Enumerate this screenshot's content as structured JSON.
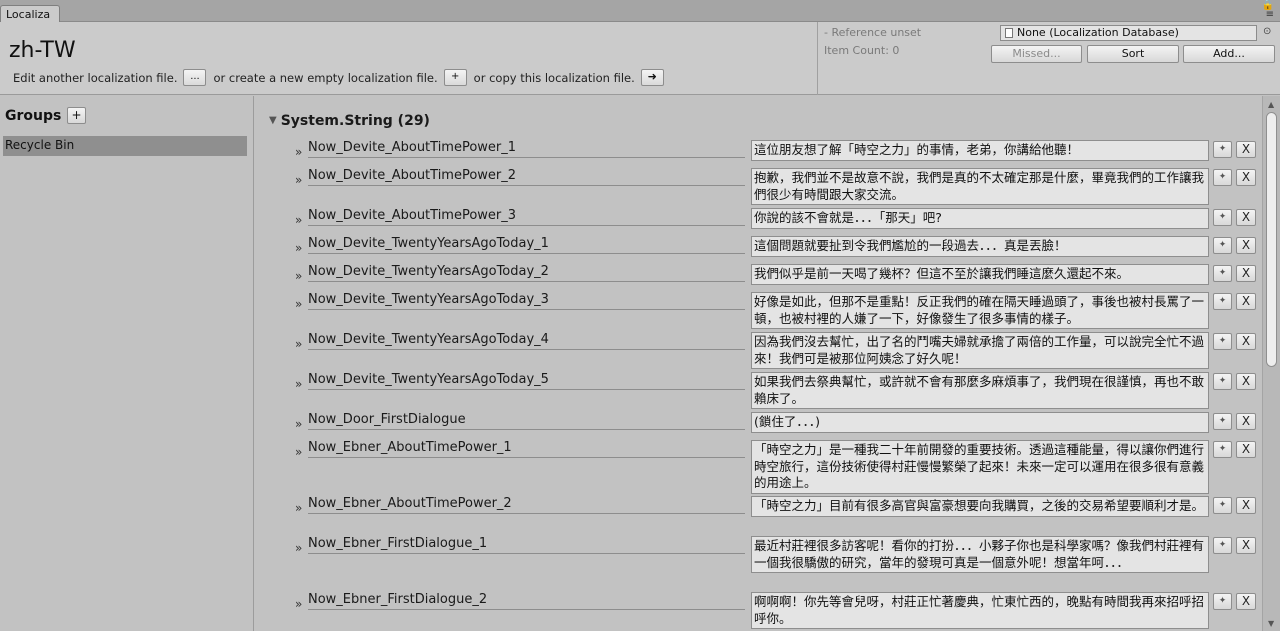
{
  "window": {
    "tab_label": "Localiza",
    "lock_glyph": "🔒",
    "menu_glyph": "≡"
  },
  "header": {
    "title": "zh-TW",
    "edit_text": "Edit another localization file.",
    "edit_button": "...",
    "create_text": "or create a new empty localization file.",
    "create_button": "+",
    "copy_text": "or copy this localization file.",
    "copy_button": "➜",
    "reference_status": "- Reference unset",
    "item_count": "Item Count: 0",
    "database_field": "None (Localization Database)",
    "missed_button": "Missed...",
    "sort_button": "Sort",
    "add_button": "Add..."
  },
  "sidebar": {
    "title": "Groups",
    "add_button": "+",
    "items": [
      {
        "label": "Recycle Bin"
      }
    ]
  },
  "section": {
    "title": "System.String (29)"
  },
  "entries": [
    {
      "key": "Now_Devite_AboutTimePower_1",
      "value": "這位朋友想了解「時空之力」的事情，老弟，你講給他聽！"
    },
    {
      "key": "Now_Devite_AboutTimePower_2",
      "value": "抱歉，我們並不是故意不說，我們是真的不太確定那是什麼，畢竟我們的工作讓我們很少有時間跟大家交流。"
    },
    {
      "key": "Now_Devite_AboutTimePower_3",
      "value": "你說的該不會就是．．．「那天」吧?"
    },
    {
      "key": "Now_Devite_TwentyYearsAgoToday_1",
      "value": "這個問題就要扯到令我們尷尬的一段過去．．．真是丟臉！"
    },
    {
      "key": "Now_Devite_TwentyYearsAgoToday_2",
      "value": "我們似乎是前一天喝了幾杯？但這不至於讓我們睡這麼久還起不來。"
    },
    {
      "key": "Now_Devite_TwentyYearsAgoToday_3",
      "value": "好像是如此，但那不是重點！反正我們的確在隔天睡過頭了，事後也被村長罵了一頓，也被村裡的人嫌了一下，好像發生了很多事情的樣子。"
    },
    {
      "key": "Now_Devite_TwentyYearsAgoToday_4",
      "value": "因為我們沒去幫忙，出了名的鬥嘴夫婦就承擔了兩倍的工作量，可以說完全忙不過來！我們可是被那位阿姨念了好久呢！"
    },
    {
      "key": "Now_Devite_TwentyYearsAgoToday_5",
      "value": "如果我們去祭典幫忙，或許就不會有那麼多麻煩事了，我們現在很謹慎，再也不敢賴床了。"
    },
    {
      "key": "Now_Door_FirstDialogue",
      "value": "(鎖住了．．．)"
    },
    {
      "key": "Now_Ebner_AboutTimePower_1",
      "value": "「時空之力」是一種我二十年前開發的重要技術。透過這種能量，得以讓你們進行時空旅行，這份技術使得村莊慢慢繁榮了起來！未來一定可以運用在很多很有意義的用途上。"
    },
    {
      "key": "Now_Ebner_AboutTimePower_2",
      "value": "「時空之力」目前有很多高官與富豪想要向我購買，之後的交易希望要順利才是。"
    },
    {
      "key": "Now_Ebner_FirstDialogue_1",
      "value": "最近村莊裡很多訪客呢！看你的打扮．．．小夥子你也是科學家嗎？像我們村莊裡有一個我很驕傲的研究，當年的發現可真是一個意外呢！想當年呵．．．"
    },
    {
      "key": "Now_Ebner_FirstDialogue_2",
      "value": "啊啊啊！你先等會兒呀，村莊正忙著慶典，忙東忙西的，晚點有時間我再來招呼招呼你。"
    }
  ],
  "row_button_labels": {
    "edit": "✦",
    "delete": "X"
  }
}
